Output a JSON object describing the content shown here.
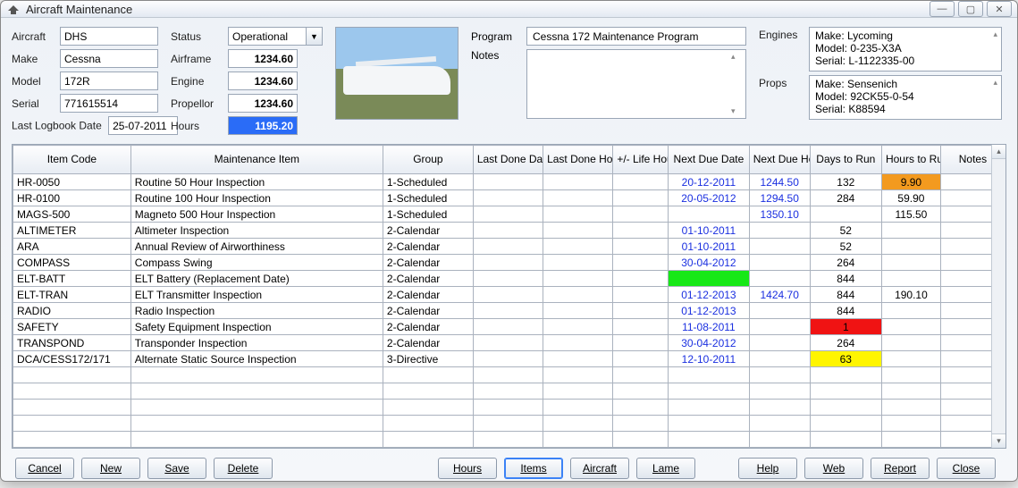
{
  "window": {
    "title": "Aircraft Maintenance"
  },
  "form": {
    "aircraft_label": "Aircraft",
    "aircraft": "DHS",
    "make_label": "Make",
    "make": "Cessna",
    "model_label": "Model",
    "model": "172R",
    "serial_label": "Serial",
    "serial": "771615514",
    "lastlog_label": "Last Logbook Date",
    "lastlog": "25-07-2011",
    "status_label": "Status",
    "status": "Operational",
    "airframe_label": "Airframe",
    "airframe": "1234.60",
    "engine_label": "Engine",
    "engine": "1234.60",
    "propellor_label": "Propellor",
    "propellor": "1234.60",
    "hours_label": "Hours",
    "hours": "1195.20",
    "program_label": "Program",
    "program": "Cessna 172 Maintenance Program",
    "notes_label": "Notes",
    "notes": "",
    "engines_label": "Engines",
    "engines_line1": "Make: Lycoming",
    "engines_line2": "Model: 0-235-X3A",
    "engines_line3": "Serial: L-1122335-00",
    "props_label": "Props",
    "props_line1": "Make: Sensenich",
    "props_line2": "Model: 92CK55-0-54",
    "props_line3": "Serial: K88594"
  },
  "columns": {
    "c0": "Item Code",
    "c1": "Maintenance Item",
    "c2": "Group",
    "c3": "Last Done Date",
    "c4": "Last Done Hours",
    "c5": "+/- Life Hours",
    "c6": "Next Due Date",
    "c7": "Next Due Hours",
    "c8": "Days to Run",
    "c9": "Hours to Run",
    "c10": "Notes"
  },
  "rows": [
    {
      "code": "HR-0050",
      "item": "Routine 50 Hour Inspection",
      "group": "1-Scheduled",
      "ldd": "",
      "ldh": "",
      "life": "",
      "ndd": "20-12-2011",
      "ndh": "1244.50",
      "days": "132",
      "hrs": "9.90",
      "hrs_c": "orange",
      "notes": ""
    },
    {
      "code": "HR-0100",
      "item": "Routine 100 Hour Inspection",
      "group": "1-Scheduled",
      "ldd": "",
      "ldh": "",
      "life": "",
      "ndd": "20-05-2012",
      "ndh": "1294.50",
      "days": "284",
      "hrs": "59.90",
      "notes": ""
    },
    {
      "code": "MAGS-500",
      "item": "Magneto 500 Hour Inspection",
      "group": "1-Scheduled",
      "ldd": "",
      "ldh": "",
      "life": "",
      "ndd": "",
      "ndh": "1350.10",
      "days": "",
      "hrs": "115.50",
      "notes": ""
    },
    {
      "code": "ALTIMETER",
      "item": "Altimeter Inspection",
      "group": "2-Calendar",
      "ldd": "",
      "ldh": "",
      "life": "",
      "ndd": "01-10-2011",
      "ndh": "",
      "days": "52",
      "hrs": "",
      "notes": ""
    },
    {
      "code": "ARA",
      "item": "Annual Review of Airworthiness",
      "group": "2-Calendar",
      "ldd": "",
      "ldh": "",
      "life": "",
      "ndd": "01-10-2011",
      "ndh": "",
      "days": "52",
      "hrs": "",
      "notes": ""
    },
    {
      "code": "COMPASS",
      "item": "Compass Swing",
      "group": "2-Calendar",
      "ldd": "",
      "ldh": "",
      "life": "",
      "ndd": "30-04-2012",
      "ndh": "",
      "days": "264",
      "hrs": "",
      "notes": ""
    },
    {
      "code": "ELT-BATT",
      "item": "ELT Battery (Replacement Date)",
      "group": "2-Calendar",
      "ldd": "",
      "ldh": "",
      "life": "",
      "ndd": "",
      "ndd_c": "green",
      "ndh": "",
      "days": "844",
      "hrs": "",
      "notes": ""
    },
    {
      "code": "ELT-TRAN",
      "item": "ELT Transmitter Inspection",
      "group": "2-Calendar",
      "ldd": "",
      "ldh": "",
      "life": "",
      "ndd": "01-12-2013",
      "ndh": "1424.70",
      "days": "844",
      "hrs": "190.10",
      "notes": ""
    },
    {
      "code": "RADIO",
      "item": "Radio Inspection",
      "group": "2-Calendar",
      "ldd": "",
      "ldh": "",
      "life": "",
      "ndd": "01-12-2013",
      "ndh": "",
      "days": "844",
      "hrs": "",
      "notes": ""
    },
    {
      "code": "SAFETY",
      "item": "Safety Equipment Inspection",
      "group": "2-Calendar",
      "ldd": "",
      "ldh": "",
      "life": "",
      "ndd": "11-08-2011",
      "ndh": "",
      "days": "1",
      "days_c": "red",
      "hrs": "",
      "notes": ""
    },
    {
      "code": "TRANSPOND",
      "item": "Transponder Inspection",
      "group": "2-Calendar",
      "ldd": "",
      "ldh": "",
      "life": "",
      "ndd": "30-04-2012",
      "ndh": "",
      "days": "264",
      "hrs": "",
      "notes": ""
    },
    {
      "code": "DCA/CESS172/171",
      "item": "Alternate Static Source Inspection",
      "group": "3-Directive",
      "ldd": "",
      "ldh": "",
      "life": "",
      "ndd": "12-10-2011",
      "ndh": "",
      "days": "63",
      "days_c": "yellow",
      "hrs": "",
      "notes": ""
    }
  ],
  "buttons": {
    "cancel": "Cancel",
    "new": "New",
    "save": "Save",
    "delete": "Delete",
    "hours": "Hours",
    "items": "Items",
    "aircraft": "Aircraft",
    "lame": "Lame",
    "help": "Help",
    "web": "Web",
    "report": "Report",
    "close": "Close"
  }
}
